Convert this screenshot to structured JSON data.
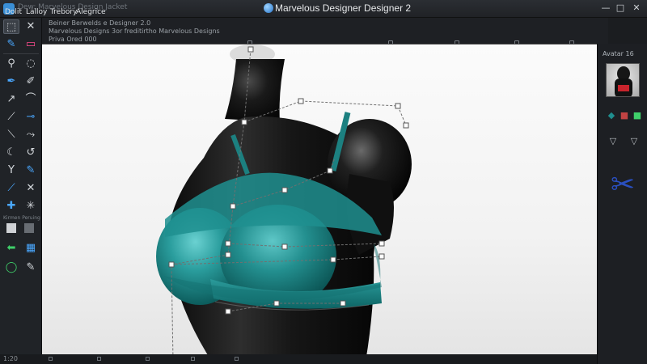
{
  "window": {
    "title": "Marvelous Designer Designer 2",
    "path": "Dew: Marvelous Design Jacket",
    "controls": [
      "—",
      "□",
      "✕"
    ]
  },
  "menu": {
    "items": [
      "Dolit",
      "Lalloy",
      "Trebory",
      "Alegrice"
    ]
  },
  "info": {
    "line1": "Beiner Berwelds e Designer 2.0",
    "line2": "Marvelous Designs 3or freditirtho Marvelous Designs",
    "line3": "Priva Ored 000"
  },
  "left_toolbar": {
    "caption1": "Kirmen Peruing"
  },
  "right_panel": {
    "header": "Avatar 16"
  },
  "statusbar": {
    "coord": "1:20"
  },
  "colors": {
    "garment": "#1f8e8e",
    "avatar": "#151515",
    "accent": "#3a8fd6"
  }
}
